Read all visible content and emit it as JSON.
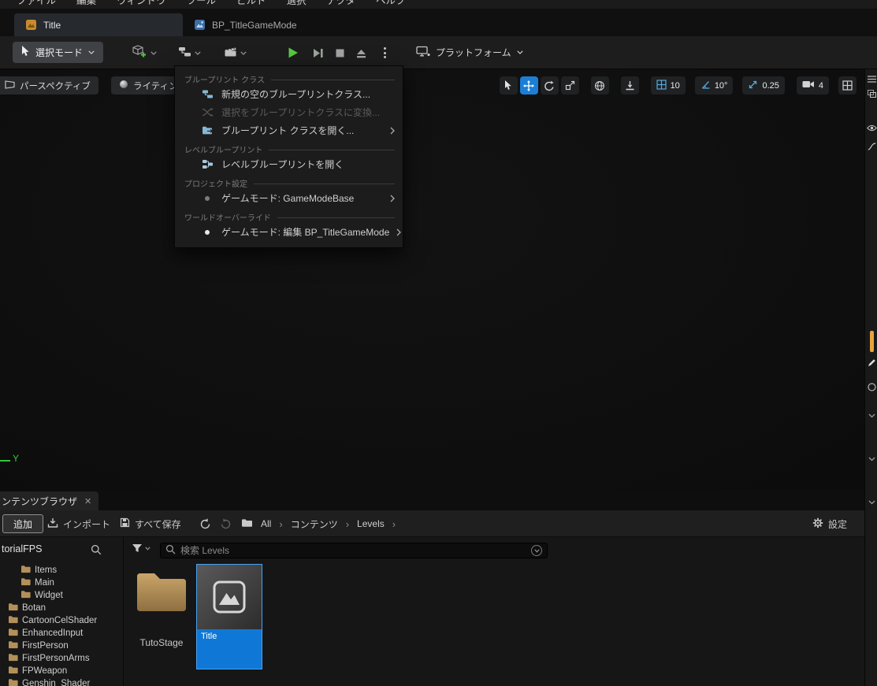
{
  "menubar": {
    "items": [
      "ファイル",
      "編集",
      "ウィンドウ",
      "ツール",
      "ビルド",
      "選択",
      "アクタ",
      "ヘルプ"
    ]
  },
  "tab_bar": {
    "tabs": [
      {
        "label": "Title",
        "icon": "level-icon",
        "active": true
      },
      {
        "label": "BP_TitleGameMode",
        "icon": "blueprint-asset-icon",
        "active": false
      }
    ]
  },
  "toolbar": {
    "mode_label": "選択モード",
    "platform_label": "プラットフォーム",
    "icons": [
      "cursor-icon",
      "add-actor-icon",
      "blueprints-icon",
      "cinematics-icon",
      "play-icon",
      "frame-skip-icon",
      "stop-icon",
      "eject-icon",
      "kebab-icon",
      "platforms-icon"
    ]
  },
  "bp_menu": {
    "sections": [
      {
        "header": "ブループリント クラス",
        "items": [
          {
            "label": "新規の空のブループリントクラス...",
            "icon": "blueprint-add-icon",
            "disabled": false,
            "has_submenu": false
          },
          {
            "label": "選択をブループリントクラスに変換...",
            "icon": "convert-selection-icon",
            "disabled": true,
            "has_submenu": false
          },
          {
            "label": "ブループリント クラスを開く...",
            "icon": "blueprint-open-icon",
            "disabled": false,
            "has_submenu": true
          }
        ]
      },
      {
        "header": "レベルブループリント",
        "items": [
          {
            "label": "レベルブループリントを開く",
            "icon": "level-blueprint-icon",
            "disabled": false,
            "has_submenu": false
          }
        ]
      },
      {
        "header": "プロジェクト設定",
        "items": [
          {
            "label": "ゲームモード: GameModeBase",
            "icon": "bullet-icon",
            "disabled": false,
            "has_submenu": true
          }
        ]
      },
      {
        "header": "ワールドオーバーライド",
        "items": [
          {
            "label": "ゲームモード: 編集 BP_TitleGameMode",
            "icon": "bullet-icon",
            "disabled": false,
            "has_submenu": true
          }
        ]
      }
    ]
  },
  "viewport": {
    "perspective_label": "パースペクティブ",
    "lit_label": "ライティング",
    "snaps": {
      "grid": "10",
      "rotation": "10°",
      "scale": "0.25",
      "camera_speed": "4"
    },
    "axis_label": "Y"
  },
  "content_browser": {
    "tab_label": "ンテンツブラウザ",
    "close_label": "✕",
    "toolbar": {
      "add": "追加",
      "import": "インポート",
      "save_all": "すべて保存",
      "settings": "設定"
    },
    "breadcrumb": {
      "root": "All",
      "path": [
        "コンテンツ",
        "Levels"
      ],
      "sep": "›"
    },
    "search_placeholder": "検索 Levels",
    "sources": {
      "header": "torialFPS",
      "folders": [
        "Items",
        "Main",
        "Widget",
        "Botan",
        "CartoonCelShader",
        "EnhancedInput",
        "FirstPerson",
        "FirstPersonArms",
        "FPWeapon",
        "Genshin_Shader"
      ]
    },
    "assets": [
      {
        "name": "TutoStage",
        "type": "folder",
        "selected": false
      },
      {
        "name": "Title",
        "type": "level",
        "selected": true
      }
    ]
  },
  "colors": {
    "selection_blue": "#0f78d7",
    "active_tool_blue": "#1b7fd6",
    "snap_icon_blue": "#55aae0",
    "folder_tan": "#b3905a",
    "axis_green": "#2dc937",
    "play_green": "#58c742",
    "orange_indicator": "#e8a33d"
  }
}
